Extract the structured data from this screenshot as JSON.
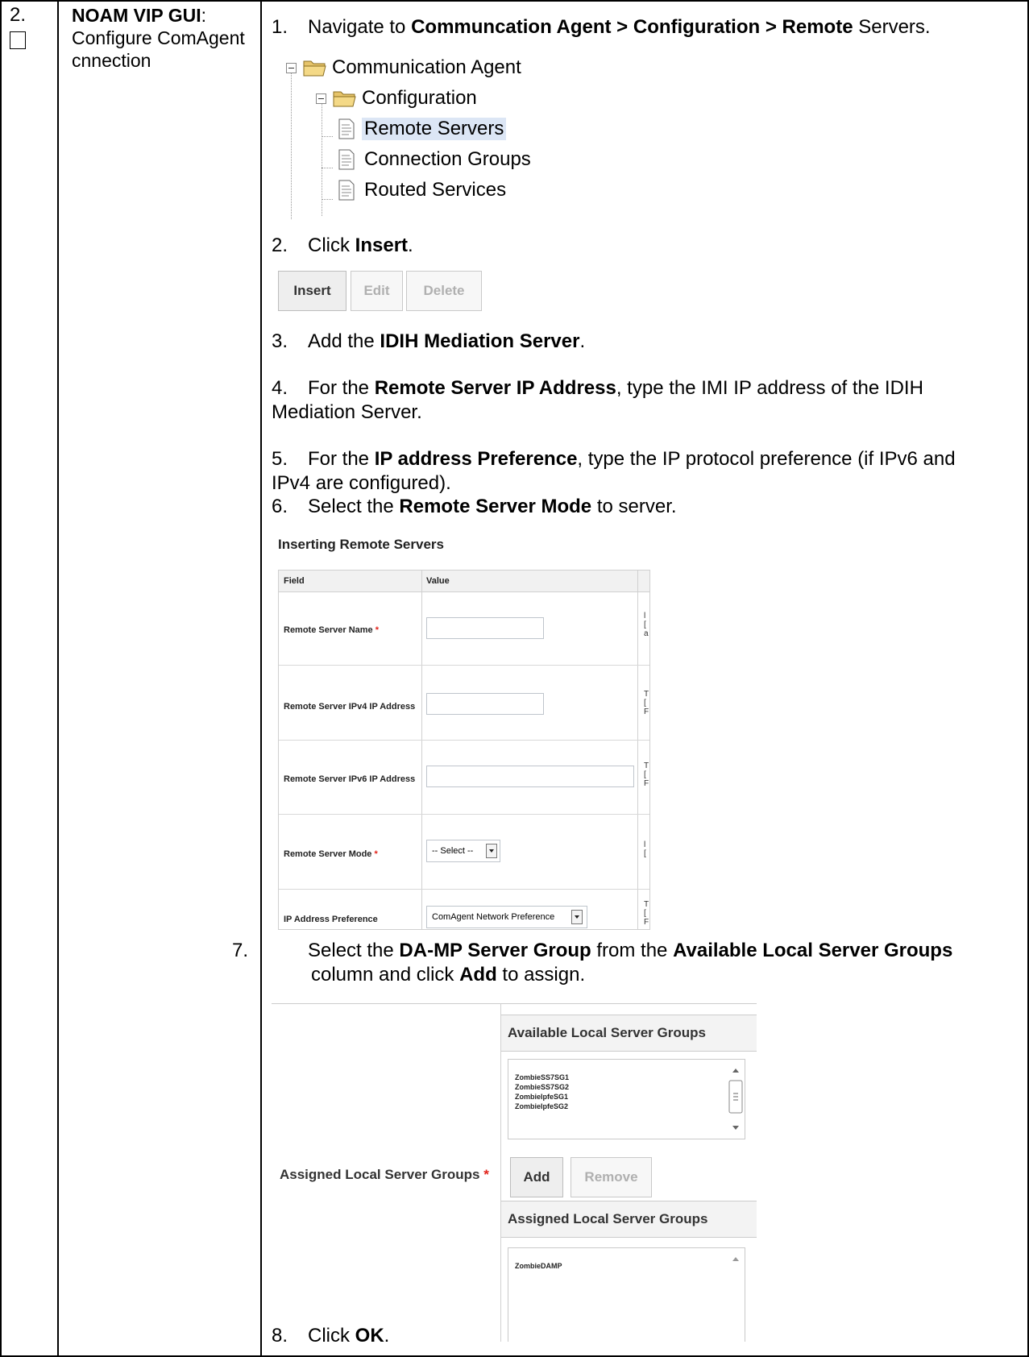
{
  "row": {
    "number": "2.",
    "title_bold": "NOAM VIP GUI",
    "title_rest": ": Configure ComAgent cnnection"
  },
  "steps": {
    "s1": {
      "n": "1.",
      "a": "Navigate to ",
      "b": "Communcation Agent > Configuration > Remote",
      "c": " Servers."
    },
    "s2": {
      "n": "2.",
      "a": "Click ",
      "b": "Insert",
      "c": "."
    },
    "s3": {
      "n": "3.",
      "a": "Add the ",
      "b": "IDIH Mediation Server",
      "c": "."
    },
    "s4": {
      "n": "4.",
      "a": "For the ",
      "b": "Remote Server IP Address",
      "c": ", type the IMI IP address of the IDIH Mediation Server."
    },
    "s5": {
      "n": "5.",
      "a": "For the ",
      "b": "IP address Preference",
      "c": ", type the IP protocol preference (if IPv6 and IPv4 are configured)."
    },
    "s6": {
      "n": "6.",
      "a": "Select the ",
      "b": "Remote Server Mode",
      "c": " to server."
    },
    "s7": {
      "n": "7.",
      "a": "Select the ",
      "b": "DA-MP Server Group",
      "c": " from the ",
      "d": "Available Local Server Groups",
      "e": " column and click ",
      "f": "Add",
      "g": " to assign."
    },
    "s8": {
      "n": "8.",
      "a": "Click ",
      "b": "OK",
      "c": "."
    }
  },
  "tree": {
    "root": "Communication Agent",
    "config": "Configuration",
    "items": [
      "Remote Servers",
      "Connection Groups",
      "Routed Services"
    ]
  },
  "toolbar": {
    "insert": "Insert",
    "edit": "Edit",
    "delete": "Delete"
  },
  "form": {
    "title": "Inserting Remote Servers",
    "col_field": "Field",
    "col_value": "Value",
    "fields": [
      {
        "label": "Remote Server Name",
        "required": "*"
      },
      {
        "label": "Remote Server IPv4 IP Address",
        "required": ""
      },
      {
        "label": "Remote Server IPv6 IP Address",
        "required": ""
      },
      {
        "label": "Remote Server Mode",
        "required": "*",
        "value": "-- Select --"
      },
      {
        "label": "IP Address Preference",
        "required": "",
        "value": "ComAgent Network Preference"
      }
    ]
  },
  "groups": {
    "label": "Assigned Local Server Groups",
    "required": "*",
    "available_header": "Available Local Server Groups",
    "available": [
      "ZombieSS7SG1",
      "ZombieSS7SG2",
      "ZombieIpfeSG1",
      "ZombieIpfeSG2"
    ],
    "add": "Add",
    "remove": "Remove",
    "assigned_header": "Assigned Local Server Groups",
    "assigned": [
      "ZombieDAMP"
    ]
  }
}
